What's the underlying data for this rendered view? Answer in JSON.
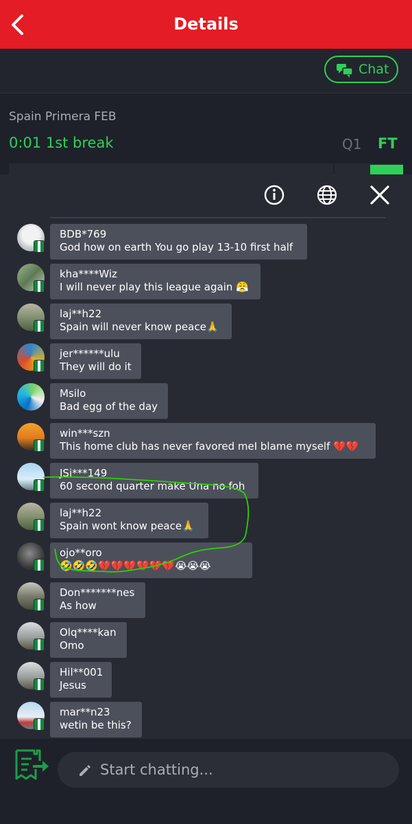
{
  "header": {
    "title": "Details",
    "back_label": "Back"
  },
  "chat_button": {
    "label": "Chat"
  },
  "match": {
    "league": "Spain Primera FEB",
    "time": "0:01 1st break",
    "q1": "Q1",
    "ft": "FT"
  },
  "messages": [
    {
      "name": "BDB*769",
      "text": "God how on earth You go play 13-10 first half"
    },
    {
      "name": "kha****Wiz",
      "text": "I will never play this league again 😤"
    },
    {
      "name": "laj**h22",
      "text": "Spain will never know peace🙏"
    },
    {
      "name": "jer******ulu",
      "text": "They will do it"
    },
    {
      "name": "Msilo",
      "text": "Bad egg of the day"
    },
    {
      "name": "win***szn",
      "text": "This home club has never favored meI blame myself 💔💔"
    },
    {
      "name": "JSi***149",
      "text": "60 second quarter make Una no foh"
    },
    {
      "name": "laj**h22",
      "text": "Spain wont know peace🙏"
    },
    {
      "name": "ojo**oro",
      "text": "🤣🤣🤣💔💔💔💔💔💔😭😭😭"
    },
    {
      "name": "Don*******nes",
      "text": "As how"
    },
    {
      "name": "Olq****kan",
      "text": "Omo"
    },
    {
      "name": "Hil**001",
      "text": "Jesus"
    },
    {
      "name": "mar**n23",
      "text": "wetin be this?"
    }
  ],
  "input": {
    "placeholder": "Start chatting..."
  },
  "colors": {
    "brand_red": "#e31c25",
    "accent_green": "#2ed158",
    "bubble": "#4c505b",
    "background": "#1e2129"
  }
}
